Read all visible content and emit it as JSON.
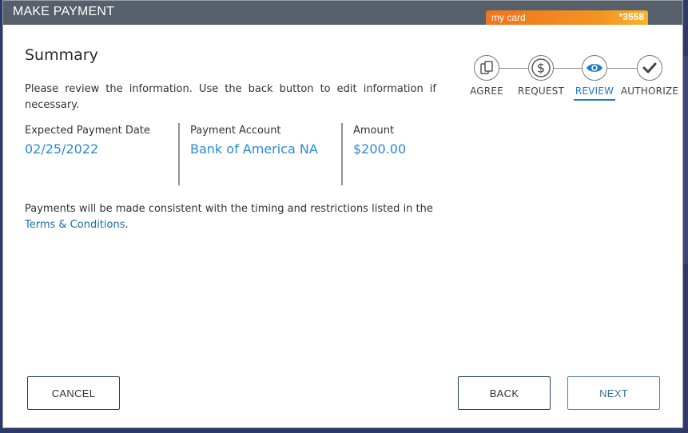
{
  "window": {
    "title": "MAKE PAYMENT"
  },
  "card": {
    "name": "my card",
    "number": "*3558"
  },
  "summary": {
    "heading": "Summary",
    "intro": "Please review the information. Use the back button to edit information if necessary."
  },
  "details": {
    "date_label": "Expected Payment Date",
    "date_value": "02/25/2022",
    "account_label": "Payment Account",
    "account_value": "Bank of America NA",
    "amount_label": "Amount",
    "amount_value": "$200.00"
  },
  "terms": {
    "text": "Payments will be made consistent with the timing and restrictions listed in the",
    "link": "Terms & Conditions",
    "end": "."
  },
  "steps": [
    {
      "label": "AGREE",
      "icon": "documents-icon",
      "state": "complete"
    },
    {
      "label": "REQUEST",
      "icon": "dollar-icon",
      "state": "complete"
    },
    {
      "label": "REVIEW",
      "icon": "eye-icon",
      "state": "active"
    },
    {
      "label": "AUTHORIZE",
      "icon": "checkmark-icon",
      "state": "upcoming"
    }
  ],
  "buttons": {
    "cancel": "CANCEL",
    "back": "BACK",
    "next": "NEXT"
  },
  "colors": {
    "titlebar": "#57606a",
    "accent": "#2b8ad0",
    "card_gradient_start": "#f0741f",
    "card_gradient_end": "#f6b528"
  }
}
